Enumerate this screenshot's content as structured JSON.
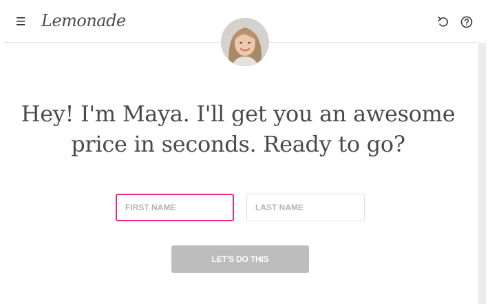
{
  "header": {
    "logo_text": "Lemonade",
    "menu_icon": "hamburger-menu-icon",
    "refresh_icon": "restart-icon",
    "help_icon": "help-circle-icon"
  },
  "assistant": {
    "avatar_icon": "assistant-avatar"
  },
  "main": {
    "headline": "Hey! I'm Maya. I'll get you an awesome price in seconds. Ready to go?",
    "first_name_placeholder": "FIRST NAME",
    "last_name_placeholder": "LAST NAME",
    "submit_label": "LET'S DO THIS"
  },
  "colors": {
    "accent": "#e62a8f",
    "button_disabled": "#bdbdbd",
    "text": "#4a4a4a"
  }
}
